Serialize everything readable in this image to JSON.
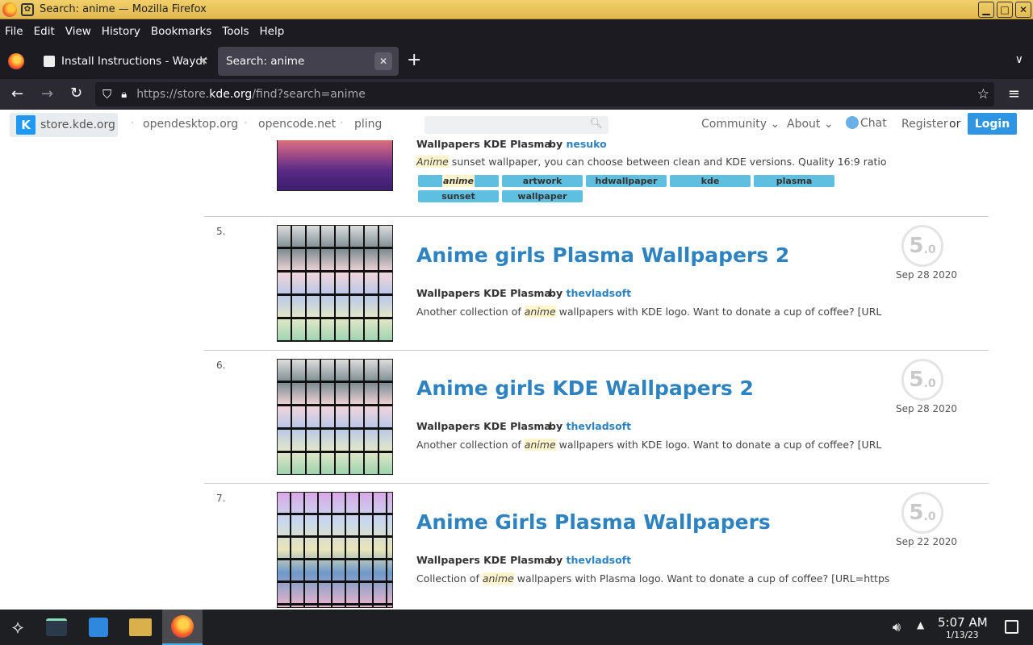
{
  "window": {
    "title": "Search: anime — Mozilla Firefox",
    "controls": {
      "minimize": "▁",
      "maximize": "□",
      "close": "✕"
    }
  },
  "menu": [
    "File",
    "Edit",
    "View",
    "History",
    "Bookmarks",
    "Tools",
    "Help"
  ],
  "tabs": [
    {
      "label": "Install Instructions - Waydr",
      "close": "✕"
    },
    {
      "label": "Search: anime",
      "close": "✕"
    }
  ],
  "newtab": "+",
  "tablist": "∨",
  "nav": {
    "back": "←",
    "forward": "→",
    "reload": "↻",
    "url_prefix": "https://store.",
    "url_host": "kde.org",
    "url_suffix": "/find?search=anime",
    "bookmark": "☆",
    "menu": "≡"
  },
  "site": {
    "logo_label": "store.kde.org",
    "links": [
      "opendesktop.org",
      "opencode.net",
      "pling"
    ],
    "community": "Community ⌄",
    "about": "About ⌄",
    "chat": "Chat",
    "register": "Register",
    "or": "or",
    "login": "Login"
  },
  "results": [
    {
      "rank": "",
      "title": "",
      "category": "Wallpapers KDE Plasma",
      "by": "by",
      "author": "nesuko",
      "desc_pre": "",
      "desc_hl": "Anime",
      "desc_post": " sunset wallpaper, you can choose between clean and KDE versions. Quality 16:9 ratio",
      "tags": [
        "anime",
        "artwork",
        "hdwallpaper",
        "kde",
        "plasma",
        "sunset",
        "wallpaper"
      ]
    },
    {
      "rank": "5.",
      "title": "Anime girls Plasma Wallpapers 2",
      "category": "Wallpapers KDE Plasma",
      "by": "by",
      "author": "thevladsoft",
      "desc_pre": "Another collection of ",
      "desc_hl": "anime",
      "desc_post": " wallpapers with KDE logo. Want to donate a cup of coffee? [URL",
      "score_main": "5",
      "score_dec": ".0",
      "date": "Sep 28 2020"
    },
    {
      "rank": "6.",
      "title": "Anime girls KDE Wallpapers 2",
      "category": "Wallpapers KDE Plasma",
      "by": "by",
      "author": "thevladsoft",
      "desc_pre": "Another collection of ",
      "desc_hl": "anime",
      "desc_post": " wallpapers with KDE logo. Want to donate a cup of coffee? [URL",
      "score_main": "5",
      "score_dec": ".0",
      "date": "Sep 28 2020"
    },
    {
      "rank": "7.",
      "title": "Anime Girls Plasma Wallpapers",
      "category": "Wallpapers KDE Plasma",
      "by": "by",
      "author": "thevladsoft",
      "desc_pre": "Collection of ",
      "desc_hl": "anime",
      "desc_post": " wallpapers with Plasma logo. Want to donate a cup of coffee? [URL=https",
      "score_main": "5",
      "score_dec": ".0",
      "date": "Sep 22 2020"
    }
  ],
  "taskbar": {
    "time": "5:07 AM",
    "date": "1/13/23"
  },
  "icons": {
    "launcher": "launcher-icon",
    "settings": "system-settings-icon",
    "store": "discover-store-icon",
    "files": "file-manager-icon",
    "firefox": "firefox-icon",
    "volume": "volume-icon",
    "tray": "tray-expand-icon"
  }
}
